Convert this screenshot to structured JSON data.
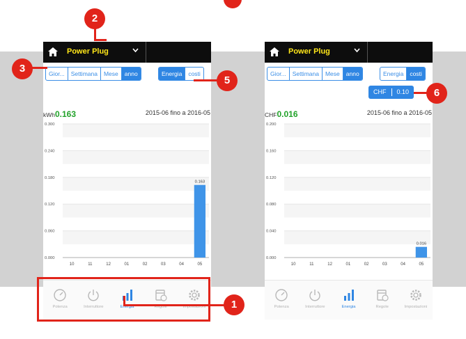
{
  "device_name": "Power Plug",
  "callouts": [
    "1",
    "2",
    "3",
    "5",
    "6"
  ],
  "accent": "#2f86e3",
  "callout_color": "#e1241a",
  "tabs_period": [
    "Gior...",
    "Settimana",
    "Mese",
    "anno"
  ],
  "active_period": "anno",
  "tabs_type": [
    "Energia",
    "costi"
  ],
  "nav": [
    {
      "label": "Potenza",
      "icon": "speedometer-icon"
    },
    {
      "label": "Interruttore",
      "icon": "power-icon"
    },
    {
      "label": "Energia",
      "icon": "bar-chart-icon"
    },
    {
      "label": "Regole",
      "icon": "calendar-icon"
    },
    {
      "label": "Impostazioni",
      "icon": "gear-icon"
    }
  ],
  "active_nav": "Energia",
  "screens": [
    {
      "active_type": "Energia",
      "unit": "kWh",
      "value": "0.163",
      "range": "2015-06 fino a 2016-05",
      "currency": null,
      "chart_data": {
        "type": "bar",
        "categories": [
          "10",
          "11",
          "12",
          "01",
          "02",
          "03",
          "04",
          "05"
        ],
        "values": [
          0,
          0,
          0,
          0,
          0,
          0,
          0,
          0.163
        ],
        "yticks": [
          "0.300",
          "0.240",
          "0.180",
          "0.120",
          "0.060",
          "0.000"
        ],
        "ylim": [
          0,
          0.3
        ],
        "bar_label": "0.163"
      }
    },
    {
      "active_type": "costi",
      "unit": "CHF",
      "value": "0.016",
      "range": "2015-06 fino a 2016-05",
      "currency": {
        "code": "CHF",
        "rate": "0.10"
      },
      "chart_data": {
        "type": "bar",
        "categories": [
          "10",
          "11",
          "12",
          "01",
          "02",
          "03",
          "04",
          "05"
        ],
        "values": [
          0,
          0,
          0,
          0,
          0,
          0,
          0,
          0.016
        ],
        "yticks": [
          "0.200",
          "0.160",
          "0.120",
          "0.080",
          "0.040",
          "0.000"
        ],
        "ylim": [
          0,
          0.2
        ],
        "bar_label": "0.016"
      }
    }
  ]
}
